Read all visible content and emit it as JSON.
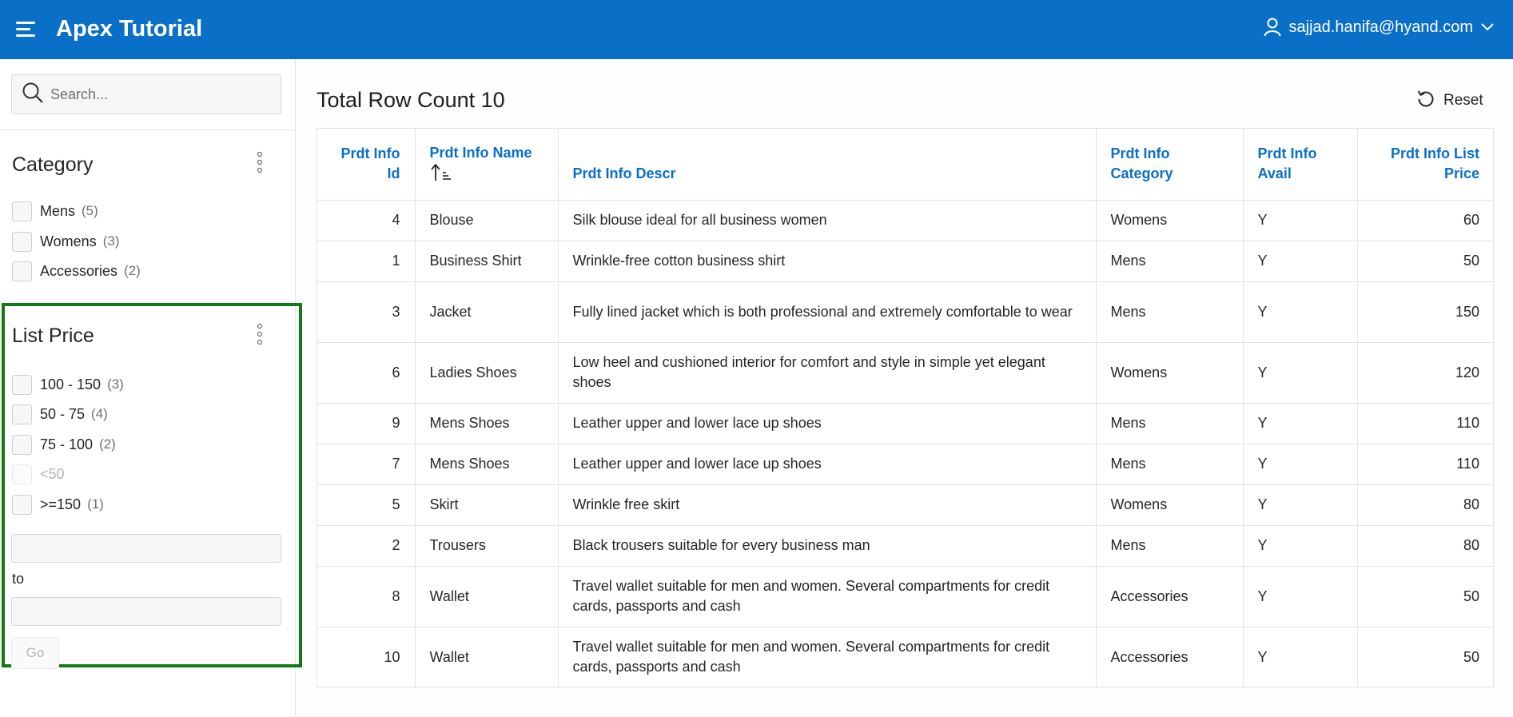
{
  "header": {
    "app_title": "Apex Tutorial",
    "user": "sajjad.hanifa@hyand.com"
  },
  "sidebar": {
    "search_placeholder": "Search...",
    "category": {
      "title": "Category",
      "options": [
        {
          "label": "Mens",
          "count": "(5)"
        },
        {
          "label": "Womens",
          "count": "(3)"
        },
        {
          "label": "Accessories",
          "count": "(2)"
        }
      ]
    },
    "list_price": {
      "title": "List Price",
      "options": [
        {
          "label": "100 - 150",
          "count": "(3)"
        },
        {
          "label": "50 - 75",
          "count": "(4)"
        },
        {
          "label": "75 - 100",
          "count": "(2)"
        },
        {
          "label": "<50",
          "count": ""
        },
        {
          "label": ">=150",
          "count": "(1)"
        }
      ],
      "to_label": "to",
      "go_label": "Go"
    }
  },
  "main": {
    "title": "Total Row Count 10",
    "reset_label": "Reset",
    "columns": [
      {
        "line1": "Prdt Info",
        "line2": "Id"
      },
      {
        "line1": "Prdt Info Name",
        "line2": ""
      },
      {
        "line1": "Prdt Info Descr",
        "line2": ""
      },
      {
        "line1": "Prdt Info",
        "line2": "Category"
      },
      {
        "line1": "Prdt Info",
        "line2": "Avail"
      },
      {
        "line1": "Prdt Info List",
        "line2": "Price"
      }
    ],
    "rows": [
      {
        "id": "4",
        "name": "Blouse",
        "descr": "Silk blouse ideal for all business women",
        "category": "Womens",
        "avail": "Y",
        "price": "60"
      },
      {
        "id": "1",
        "name": "Business Shirt",
        "descr": "Wrinkle-free cotton business shirt",
        "category": "Mens",
        "avail": "Y",
        "price": "50"
      },
      {
        "id": "3",
        "name": "Jacket",
        "descr": "Fully lined jacket which is both professional and extremely comfortable to wear",
        "category": "Mens",
        "avail": "Y",
        "price": "150"
      },
      {
        "id": "6",
        "name": "Ladies Shoes",
        "descr": "Low heel and cushioned interior for comfort and style in simple yet elegant shoes",
        "category": "Womens",
        "avail": "Y",
        "price": "120"
      },
      {
        "id": "9",
        "name": "Mens Shoes",
        "descr": "Leather upper and lower lace up shoes",
        "category": "Mens",
        "avail": "Y",
        "price": "110"
      },
      {
        "id": "7",
        "name": "Mens Shoes",
        "descr": "Leather upper and lower lace up shoes",
        "category": "Mens",
        "avail": "Y",
        "price": "110"
      },
      {
        "id": "5",
        "name": "Skirt",
        "descr": "Wrinkle free skirt",
        "category": "Womens",
        "avail": "Y",
        "price": "80"
      },
      {
        "id": "2",
        "name": "Trousers",
        "descr": "Black trousers suitable for every business man",
        "category": "Mens",
        "avail": "Y",
        "price": "80"
      },
      {
        "id": "8",
        "name": "Wallet",
        "descr": "Travel wallet suitable for men and women. Several compartments for credit cards, passports and cash",
        "category": "Accessories",
        "avail": "Y",
        "price": "50"
      },
      {
        "id": "10",
        "name": "Wallet",
        "descr": "Travel wallet suitable for men and women. Several compartments for credit cards, passports and cash",
        "category": "Accessories",
        "avail": "Y",
        "price": "50"
      }
    ]
  },
  "colors": {
    "header_bg": "#0a6fc7",
    "link_blue": "#0a6fc7",
    "highlight_border": "#137a13"
  }
}
